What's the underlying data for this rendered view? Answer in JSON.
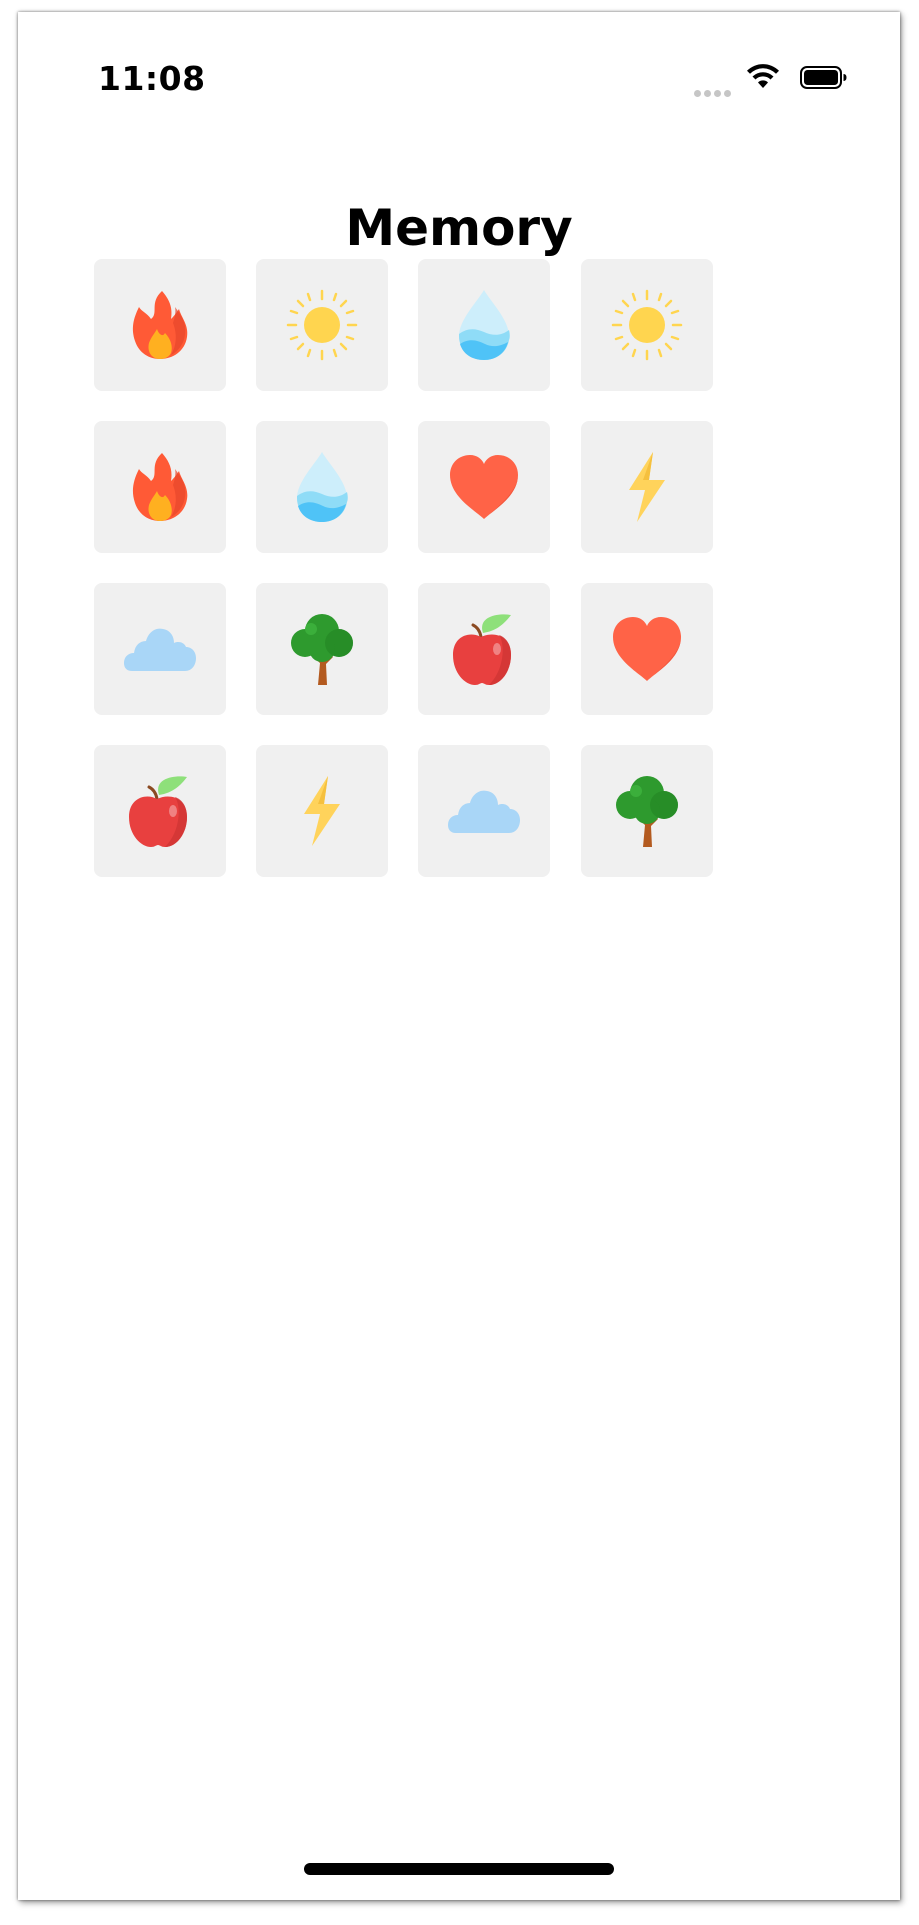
{
  "status_bar": {
    "time": "11:08",
    "signal_icon": "signal-dots-icon",
    "wifi_icon": "wifi-icon",
    "battery_icon": "battery-full-icon"
  },
  "page": {
    "title": "Memory"
  },
  "grid": {
    "rows": 4,
    "columns": 4,
    "cards": [
      {
        "icon": "fire-icon"
      },
      {
        "icon": "sun-icon"
      },
      {
        "icon": "water-drop-icon"
      },
      {
        "icon": "sun-icon"
      },
      {
        "icon": "fire-icon"
      },
      {
        "icon": "water-drop-icon"
      },
      {
        "icon": "heart-icon"
      },
      {
        "icon": "lightning-icon"
      },
      {
        "icon": "cloud-icon"
      },
      {
        "icon": "tree-icon"
      },
      {
        "icon": "apple-icon"
      },
      {
        "icon": "heart-icon"
      },
      {
        "icon": "apple-icon"
      },
      {
        "icon": "lightning-icon"
      },
      {
        "icon": "cloud-icon"
      },
      {
        "icon": "tree-icon"
      }
    ]
  },
  "colors": {
    "card_background": "#f0f0f0",
    "fire": "#ff5a36",
    "sun": "#ffd54f",
    "water": "#4fc3f7",
    "heart": "#ff6347",
    "lightning": "#ffd35b",
    "cloud": "#a9d6f7",
    "tree": "#2e9a2e",
    "apple": "#e8403f"
  }
}
